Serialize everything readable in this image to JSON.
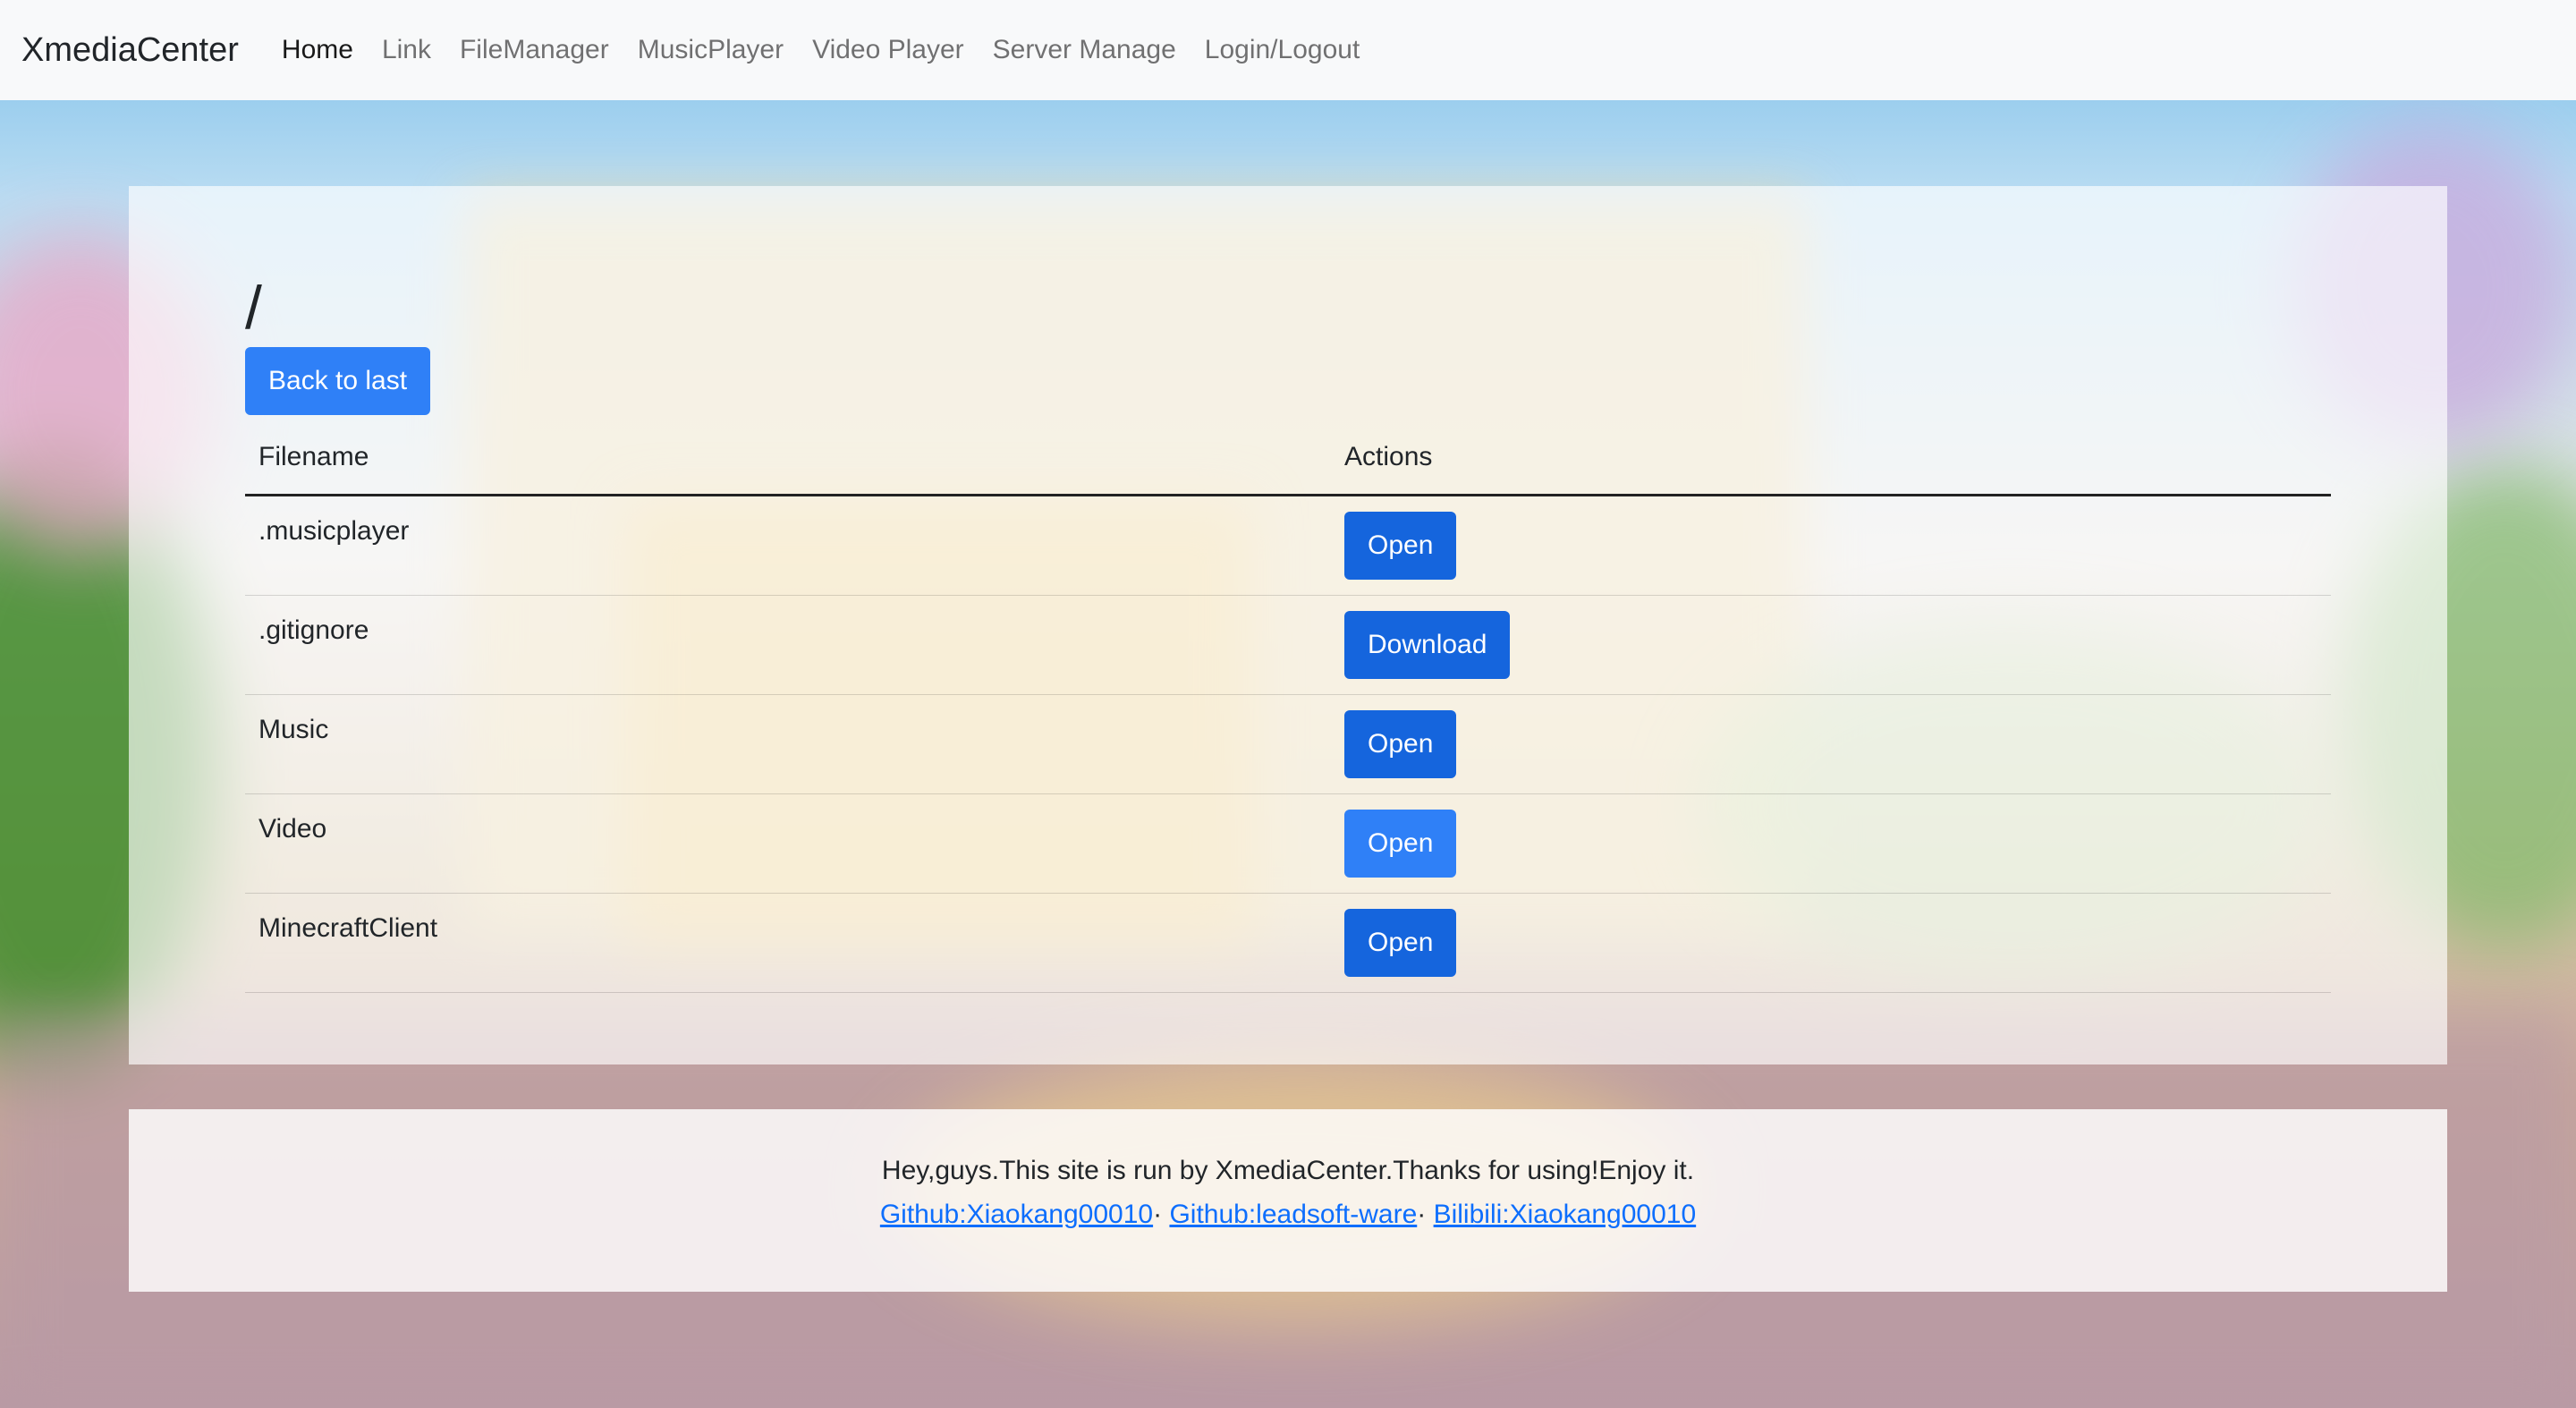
{
  "navbar": {
    "brand": "XmediaCenter",
    "items": [
      {
        "label": "Home",
        "active": true
      },
      {
        "label": "Link",
        "active": false
      },
      {
        "label": "FileManager",
        "active": false
      },
      {
        "label": "MusicPlayer",
        "active": false
      },
      {
        "label": "Video Player",
        "active": false
      },
      {
        "label": "Server Manage",
        "active": false
      },
      {
        "label": "Login/Logout",
        "active": false
      }
    ]
  },
  "main": {
    "path": "/",
    "back_button": "Back to last",
    "table": {
      "headers": {
        "filename": "Filename",
        "actions": "Actions"
      },
      "rows": [
        {
          "filename": ".musicplayer",
          "action": "Open"
        },
        {
          "filename": ".gitignore",
          "action": "Download"
        },
        {
          "filename": "Music",
          "action": "Open"
        },
        {
          "filename": "Video",
          "action": "Open"
        },
        {
          "filename": "MinecraftClient",
          "action": "Open"
        }
      ]
    }
  },
  "footer": {
    "text": "Hey,guys.This site is run by XmediaCenter.Thanks for using!Enjoy it.",
    "links": [
      {
        "label": "Github:Xiaokang00010"
      },
      {
        "label": "Github:leadsoft-ware"
      },
      {
        "label": "Bilibili:Xiaokang00010"
      }
    ],
    "separator": "·"
  },
  "colors": {
    "primary": "#0d6efd",
    "navbar_bg": "#f8f9fa"
  }
}
